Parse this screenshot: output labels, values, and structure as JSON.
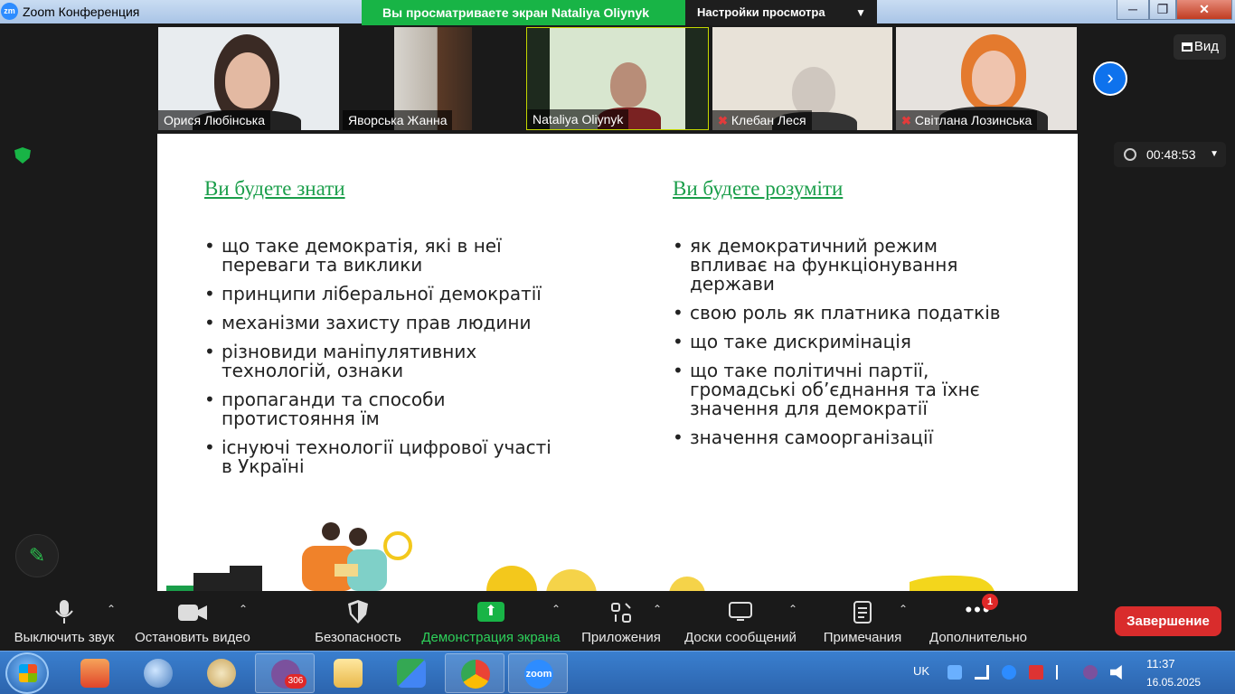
{
  "window": {
    "title": "Zoom Конференция",
    "app_icon": "zm",
    "share_banner": "Вы просматриваете экран Nataliya Oliynyk",
    "view_settings": "Настройки просмотра",
    "minimize": "─",
    "maximize": "❐",
    "close": "✕"
  },
  "participants": [
    {
      "name": "Орися Любінська",
      "muted": false
    },
    {
      "name": "Яворська Жанна",
      "muted": false
    },
    {
      "name": "Nataliya Oliynyk",
      "muted": false,
      "active": true
    },
    {
      "name": "Клебан Леся",
      "muted": true
    },
    {
      "name": "Світлана Лозинська",
      "muted": true
    }
  ],
  "view_button": "Вид",
  "next_icon": "chevron-right-icon",
  "timer": "00:48:53",
  "slide": {
    "left": {
      "heading": "Ви будете знати",
      "items": [
        "що таке демократія, які в неї переваги та виклики",
        "принципи ліберальної демократії",
        "механізми захисту прав людини",
        "різновиди маніпулятивних технологій, ознаки",
        "пропаганди та способи протистояння їм",
        "існуючі технології цифрової участі в Україні"
      ]
    },
    "right": {
      "heading": "Ви будете розуміти",
      "items": [
        "як демократичний режим впливає на функціонування держави",
        "свою роль як платника податків",
        "що таке дискримінація",
        "що таке політичні партії, громадські об’єднання та їхнє значення для демократії",
        "значення самоорганізації"
      ]
    }
  },
  "toolbar": {
    "mute": "Выключить звук",
    "video": "Остановить видео",
    "security": "Безопасность",
    "share": "Демонстрация экрана",
    "apps": "Приложения",
    "boards": "Доски сообщений",
    "notes": "Примечания",
    "more": "Дополнительно",
    "more_badge": "1",
    "end": "Завершение"
  },
  "colors": {
    "share_green": "#18b446",
    "heading_green": "#1a9e4a",
    "end_red": "#d92c2c",
    "accent_blue": "#0e72ed"
  },
  "taskbar": {
    "viber_badge": "306",
    "zoom_label": "zoom",
    "lang": "UK",
    "time": "11:37",
    "date": "16.05.2025"
  }
}
